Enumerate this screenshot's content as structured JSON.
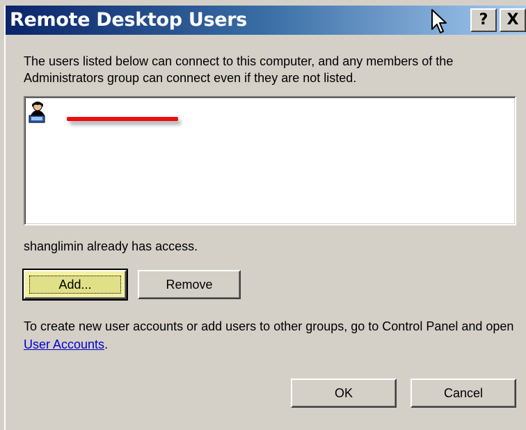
{
  "window": {
    "title": "Remote Desktop Users",
    "help_label": "?",
    "close_label": "X"
  },
  "description": "The users listed below can connect to this computer, and any members of the Administrators group can connect even if they are not listed.",
  "status": "shanglimin already has access.",
  "buttons": {
    "add_label": "Add...",
    "remove_label": "Remove",
    "ok_label": "OK",
    "cancel_label": "Cancel"
  },
  "footer": {
    "text": "To create new user accounts or add users to other groups, go to Control Panel and open ",
    "link": "User Accounts",
    "end": "."
  },
  "colors": {
    "titlebar_start": "#0a246a",
    "titlebar_end": "#a6caf0",
    "dialog_bg": "#d4d0c8",
    "redaction": "#e81010",
    "link": "#0000cc"
  },
  "icons": [
    "user-icon",
    "cursor-icon"
  ]
}
